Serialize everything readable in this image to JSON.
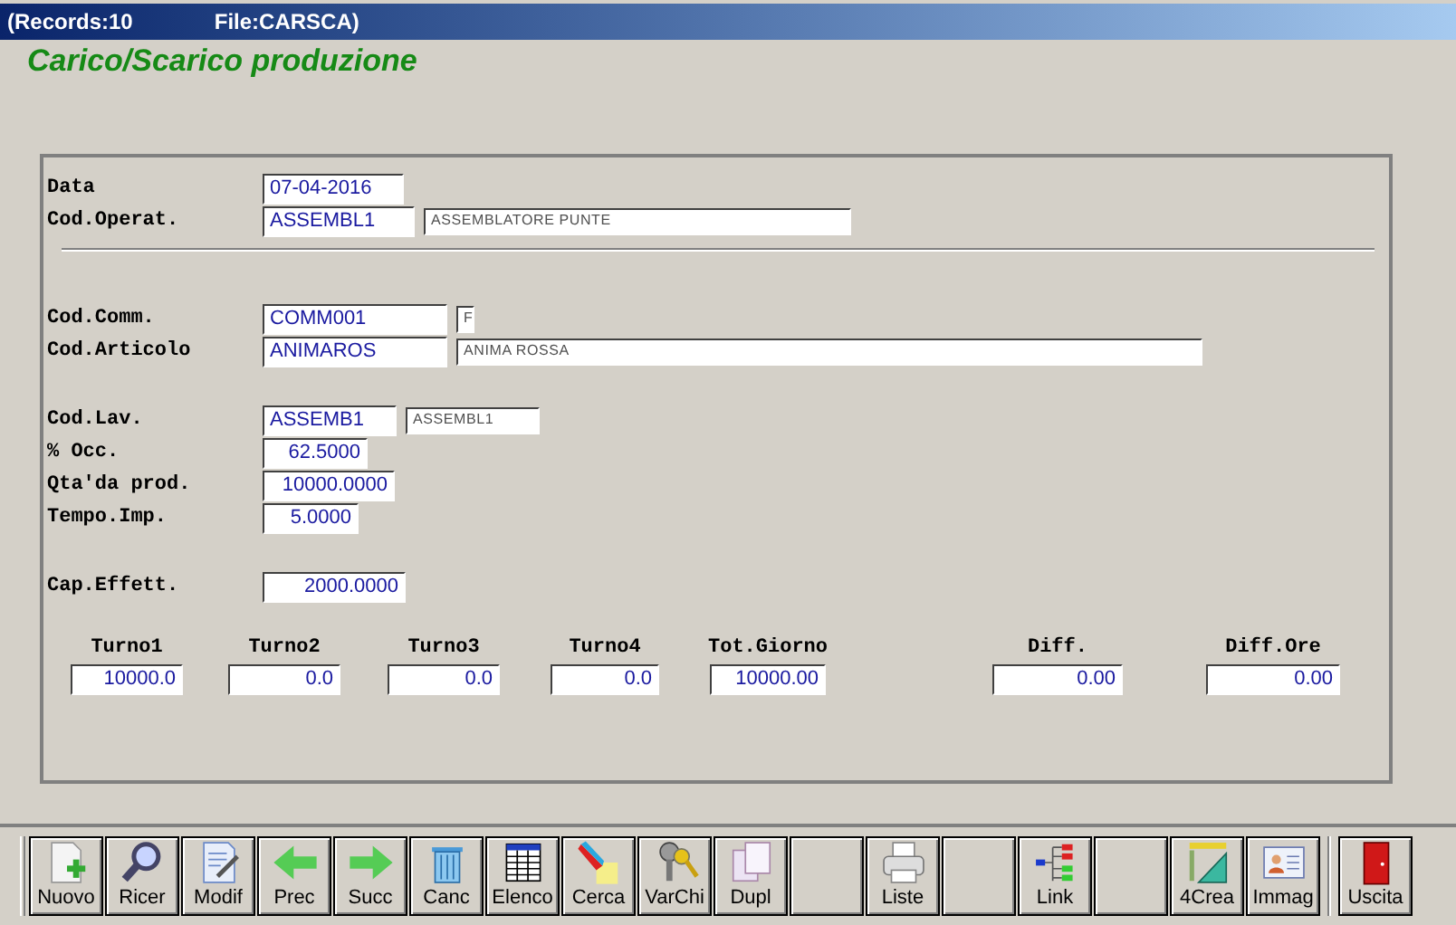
{
  "window": {
    "records": "(Records:10",
    "file": "File:CARSCA)"
  },
  "title": "Carico/Scarico produzione",
  "header_fields": [
    {
      "label": "Data",
      "inputs": [
        {
          "kind": "code",
          "value": "07-04-2016"
        }
      ]
    },
    {
      "label": "Cod.Operat.",
      "inputs": [
        {
          "kind": "code",
          "value": "ASSEMBL1"
        },
        {
          "kind": "desc",
          "value": "ASSEMBLATORE PUNTE"
        }
      ]
    }
  ],
  "fields": [
    {
      "label": "Cod.Comm.",
      "inputs": [
        {
          "kind": "code",
          "value": "COMM001"
        },
        {
          "kind": "desc",
          "value": "F"
        }
      ]
    },
    {
      "label": "Cod.Articolo",
      "inputs": [
        {
          "kind": "code",
          "value": "ANIMAROS"
        },
        {
          "kind": "desc",
          "value": "ANIMA ROSSA"
        }
      ]
    },
    {
      "label": "Cod.Lav.",
      "inputs": [
        {
          "kind": "code",
          "value": "ASSEMB1"
        },
        {
          "kind": "desc",
          "value": "ASSEMBL1"
        }
      ]
    },
    {
      "label": "% Occ.",
      "inputs": [
        {
          "kind": "number",
          "value": "62.5000"
        }
      ]
    },
    {
      "label": "Qta'da prod.",
      "inputs": [
        {
          "kind": "number",
          "value": "10000.0000"
        }
      ]
    },
    {
      "label": "Tempo.Imp.",
      "inputs": [
        {
          "kind": "number",
          "value": "5.0000"
        }
      ]
    },
    {
      "label": "Cap.Effett.",
      "inputs": [
        {
          "kind": "number",
          "value": "2000.0000"
        }
      ]
    }
  ],
  "totals": [
    {
      "label": "Turno1",
      "value": "10000.0"
    },
    {
      "label": "Turno2",
      "value": "0.0"
    },
    {
      "label": "Turno3",
      "value": "0.0"
    },
    {
      "label": "Turno4",
      "value": "0.0"
    },
    {
      "label": "Tot.Giorno",
      "value": "10000.00"
    },
    {
      "label": "Diff.",
      "value": "0.00"
    },
    {
      "label": "Diff.Ore",
      "value": "0.00"
    }
  ],
  "toolbar": [
    {
      "kind": "button",
      "label": "Nuovo"
    },
    {
      "kind": "button",
      "label": "Ricer"
    },
    {
      "kind": "button",
      "label": "Modif"
    },
    {
      "kind": "button",
      "label": "Prec"
    },
    {
      "kind": "button",
      "label": "Succ"
    },
    {
      "kind": "button",
      "label": "Canc"
    },
    {
      "kind": "button",
      "label": "Elenco"
    },
    {
      "kind": "button",
      "label": "Cerca"
    },
    {
      "kind": "button",
      "label": "VarChi"
    },
    {
      "kind": "button",
      "label": "Dupl"
    },
    {
      "kind": "blank"
    },
    {
      "kind": "button",
      "label": "Liste"
    },
    {
      "kind": "blank"
    },
    {
      "kind": "button",
      "label": "Link"
    },
    {
      "kind": "blank"
    },
    {
      "kind": "button",
      "label": "4Crea"
    },
    {
      "kind": "button",
      "label": "Immag"
    },
    {
      "kind": "separator"
    },
    {
      "kind": "button",
      "label": "Uscita"
    }
  ]
}
